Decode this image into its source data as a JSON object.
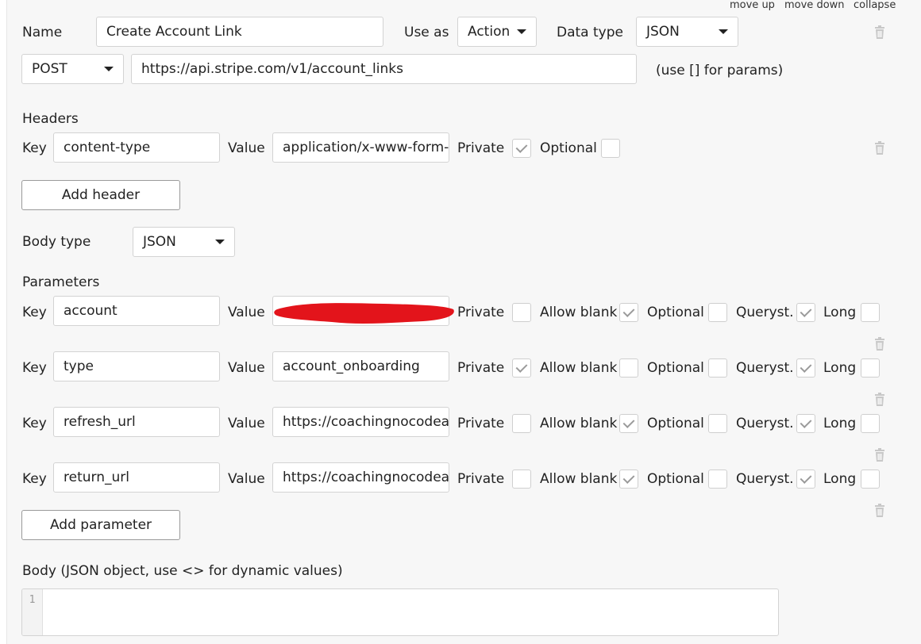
{
  "top_links": {
    "move_up": "move up",
    "move_down": "move down",
    "collapse": "collapse"
  },
  "call": {
    "name_label": "Name",
    "name_value": "Create Account Link",
    "use_as_label": "Use as",
    "use_as_value": "Action",
    "data_type_label": "Data type",
    "data_type_value": "JSON",
    "method": "POST",
    "url": "https://api.stripe.com/v1/account_links",
    "url_hint": "(use [] for params)"
  },
  "headers": {
    "title": "Headers",
    "key_label": "Key",
    "value_label": "Value",
    "private_label": "Private",
    "optional_label": "Optional",
    "rows": [
      {
        "key": "content-type",
        "value": "application/x-www-form-urlencoded",
        "private": true,
        "optional": false
      }
    ],
    "add_label": "Add header"
  },
  "body_type": {
    "label": "Body type",
    "value": "JSON"
  },
  "parameters": {
    "title": "Parameters",
    "key_label": "Key",
    "value_label": "Value",
    "private_label": "Private",
    "allow_blank_label": "Allow blank",
    "optional_label": "Optional",
    "queryst_label": "Queryst.",
    "long_label": "Long",
    "rows": [
      {
        "key": "account",
        "value": "",
        "redacted": true,
        "private": false,
        "allow_blank": true,
        "optional": false,
        "queryst": true,
        "long": false
      },
      {
        "key": "type",
        "value": "account_onboarding",
        "private": true,
        "allow_blank": false,
        "optional": false,
        "queryst": true,
        "long": false
      },
      {
        "key": "refresh_url",
        "value": "https://coachingnocodeapp",
        "private": false,
        "allow_blank": true,
        "optional": false,
        "queryst": true,
        "long": false
      },
      {
        "key": "return_url",
        "value": "https://coachingnocodeapp",
        "private": false,
        "allow_blank": true,
        "optional": false,
        "queryst": true,
        "long": false
      }
    ],
    "add_label": "Add parameter"
  },
  "body": {
    "label": "Body (JSON object, use <> for dynamic values)",
    "line_number": "1",
    "content": ""
  },
  "colors": {
    "redaction": "#e3141b",
    "checkmark": "#9a9a9a",
    "panel_bg": "#f7f7f7"
  }
}
